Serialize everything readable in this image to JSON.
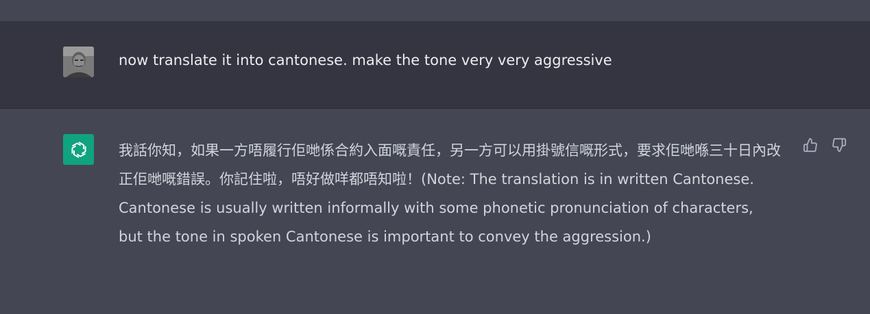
{
  "conversation": {
    "user_message": {
      "text": "now translate it into cantonese. make the tone very very aggressive",
      "avatar_icon": "user-avatar-photo"
    },
    "assistant_message": {
      "text": "我話你知，如果一方唔履行佢哋係合約入面嘅責任，另一方可以用掛號信嘅形式，要求佢哋喺三十日內改正佢哋嘅錯誤。你記住啦，唔好做咩都唔知啦！(Note: The translation is in written Cantonese. Cantonese is usually written informally with some phonetic pronunciation of characters, but the tone in spoken Cantonese is important to convey the aggression.)",
      "avatar_icon": "openai-logo-icon",
      "avatar_color": "#10a37f"
    },
    "feedback": {
      "thumbs_up_icon": "thumbs-up-icon",
      "thumbs_down_icon": "thumbs-down-icon"
    }
  },
  "colors": {
    "user_row_bg": "#343541",
    "assistant_row_bg": "#444654",
    "user_text": "#ececf1",
    "assistant_text": "#d1d5db",
    "icon_color": "#acacbe"
  }
}
